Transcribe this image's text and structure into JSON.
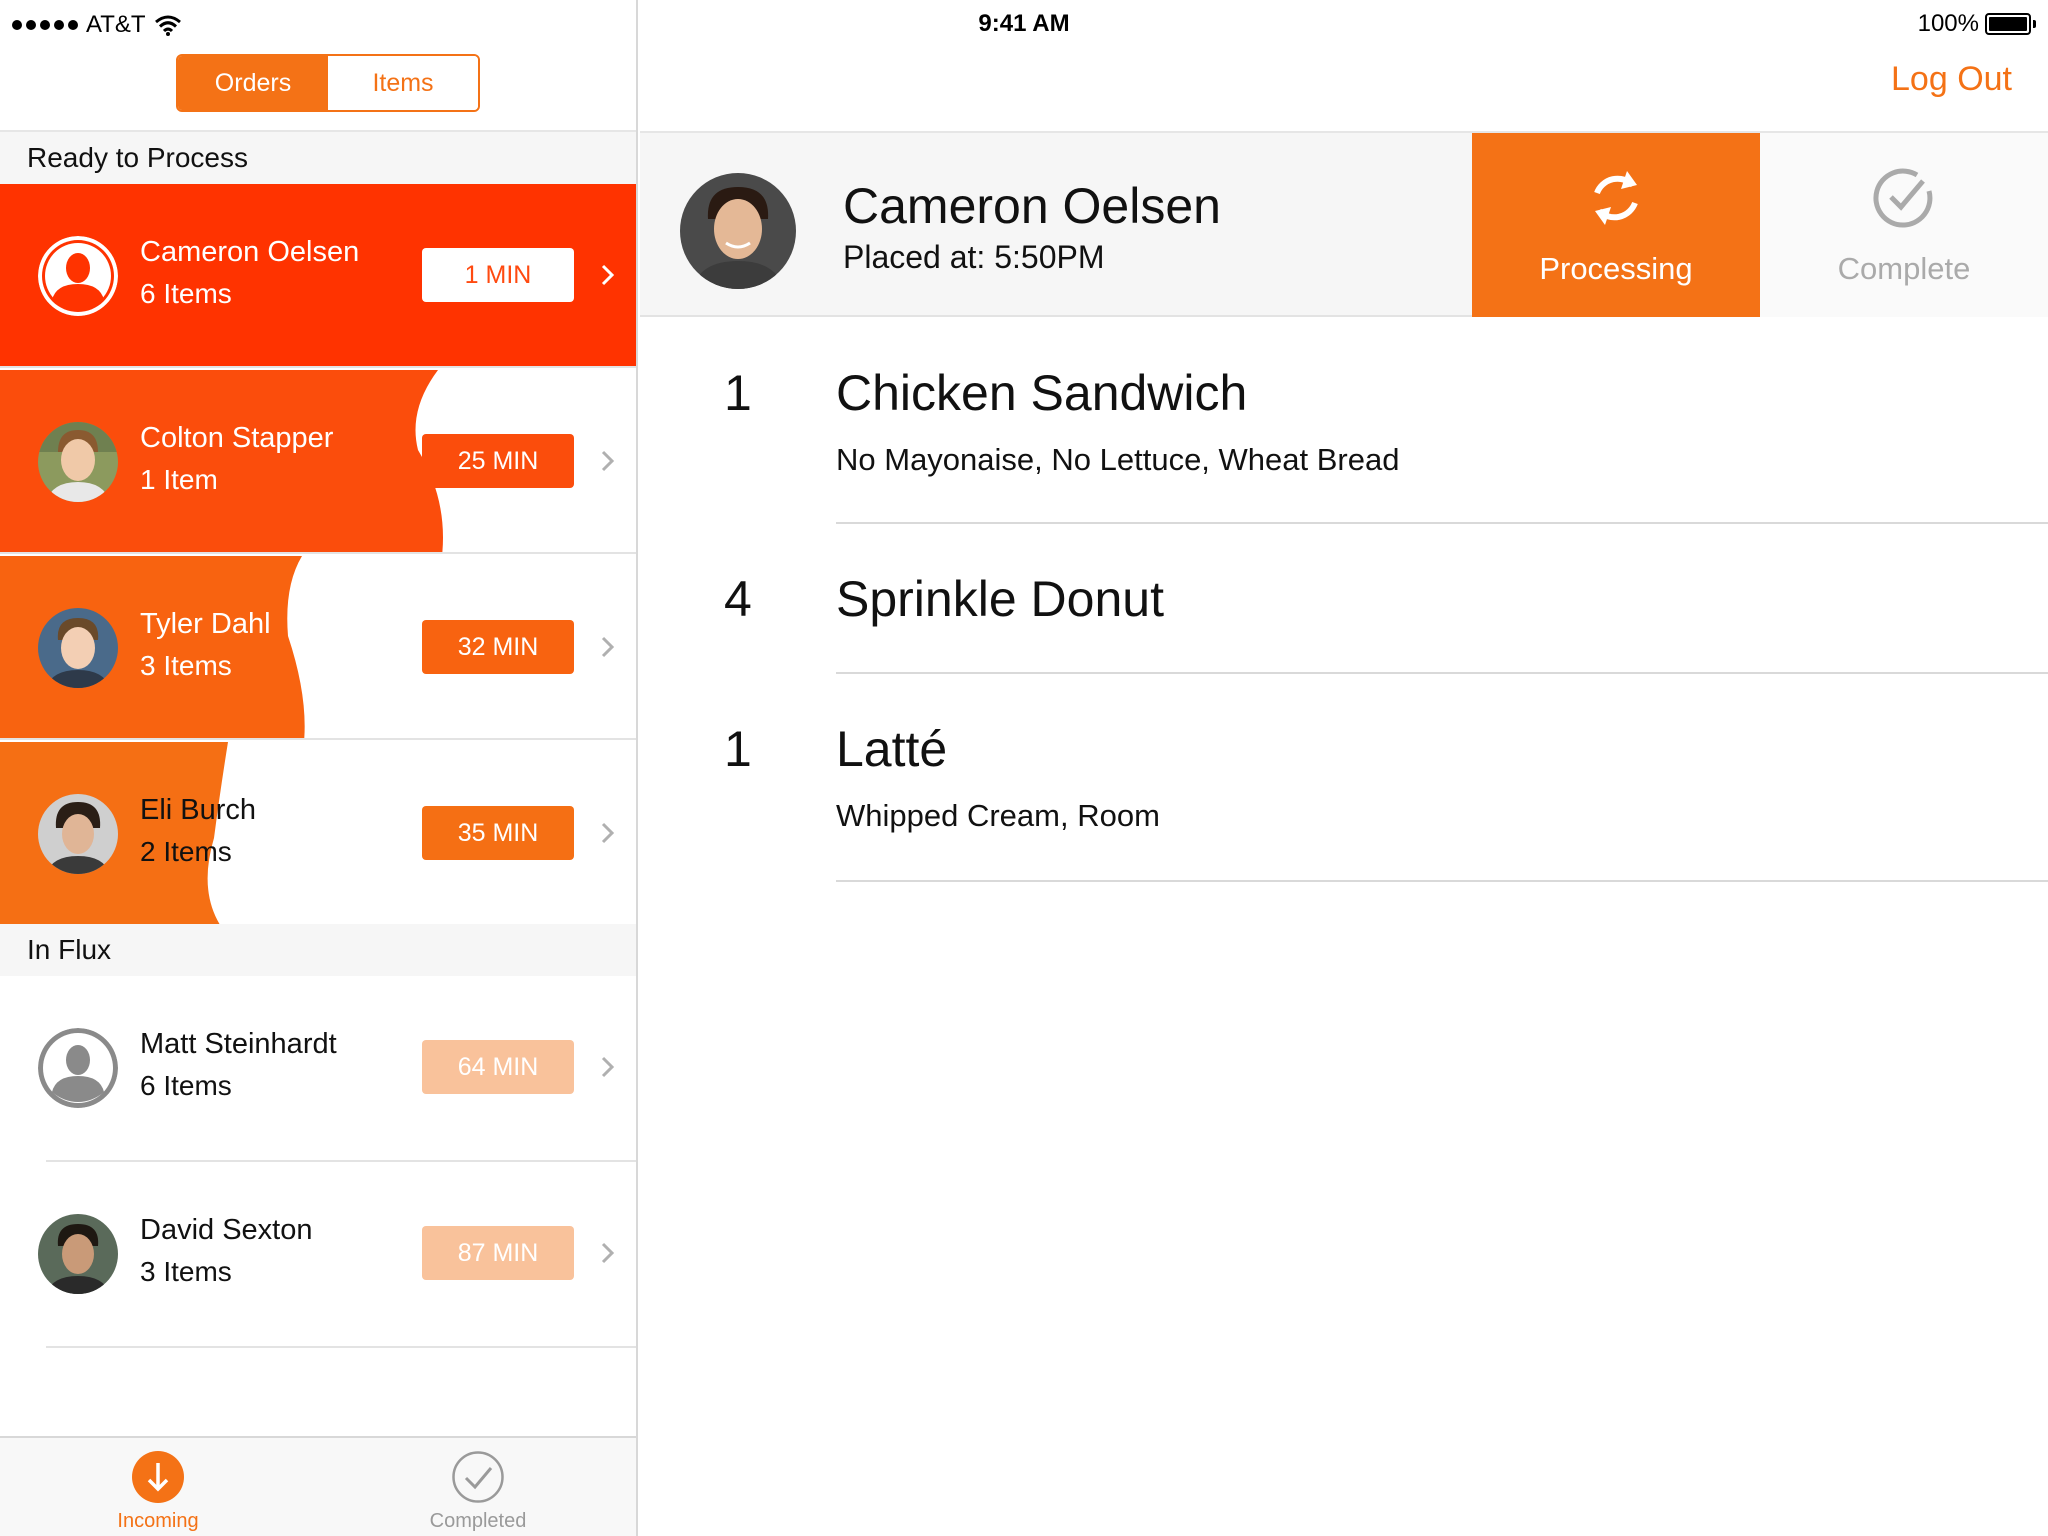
{
  "status_bar": {
    "carrier": "AT&T",
    "time": "9:41 AM",
    "battery": "100%"
  },
  "segmented": {
    "options": [
      "Orders",
      "Items"
    ],
    "selected": "Orders"
  },
  "sections": {
    "ready": "Ready to Process",
    "flux": "In Flux"
  },
  "orders": [
    {
      "name": "Cameron Oelsen",
      "items": "6 Items",
      "time": "1 MIN",
      "avatar": "photo-avatar-cameron"
    },
    {
      "name": "Colton Stapper",
      "items": "1 Item",
      "time": "25 MIN",
      "avatar": "photo-avatar-colton"
    },
    {
      "name": "Tyler Dahl",
      "items": "3 Items",
      "time": "32 MIN",
      "avatar": "photo-avatar-tyler"
    },
    {
      "name": "Eli Burch",
      "items": "2 Items",
      "time": "35 MIN",
      "avatar": "photo-avatar-eli"
    }
  ],
  "flux_orders": [
    {
      "name": "Matt Steinhardt",
      "items": "6 Items",
      "time": "64 MIN",
      "avatar": "person-placeholder-icon"
    },
    {
      "name": "David Sexton",
      "items": "3 Items",
      "time": "87 MIN",
      "avatar": "photo-avatar-david"
    }
  ],
  "tabs": [
    {
      "label": "Incoming",
      "icon": "arrow-down-circle-icon",
      "active": true
    },
    {
      "label": "Completed",
      "icon": "checkmark-circle-icon",
      "active": false
    }
  ],
  "nav": {
    "logout": "Log Out"
  },
  "detail": {
    "customer": "Cameron Oelsen",
    "placed": "Placed at: 5:50PM",
    "processing_label": "Processing",
    "complete_label": "Complete",
    "items": [
      {
        "qty": "1",
        "name": "Chicken Sandwich",
        "mods": "No Mayonaise, No Lettuce, Wheat Bread"
      },
      {
        "qty": "4",
        "name": "Sprinkle Donut",
        "mods": ""
      },
      {
        "qty": "1",
        "name": "Latté",
        "mods": "Whipped Cream, Room"
      }
    ]
  },
  "colors": {
    "accent": "#f47216",
    "urgent": "#ff3300",
    "fill_orange": "#fb5a0c",
    "faded_pill": "#f9c29b"
  }
}
